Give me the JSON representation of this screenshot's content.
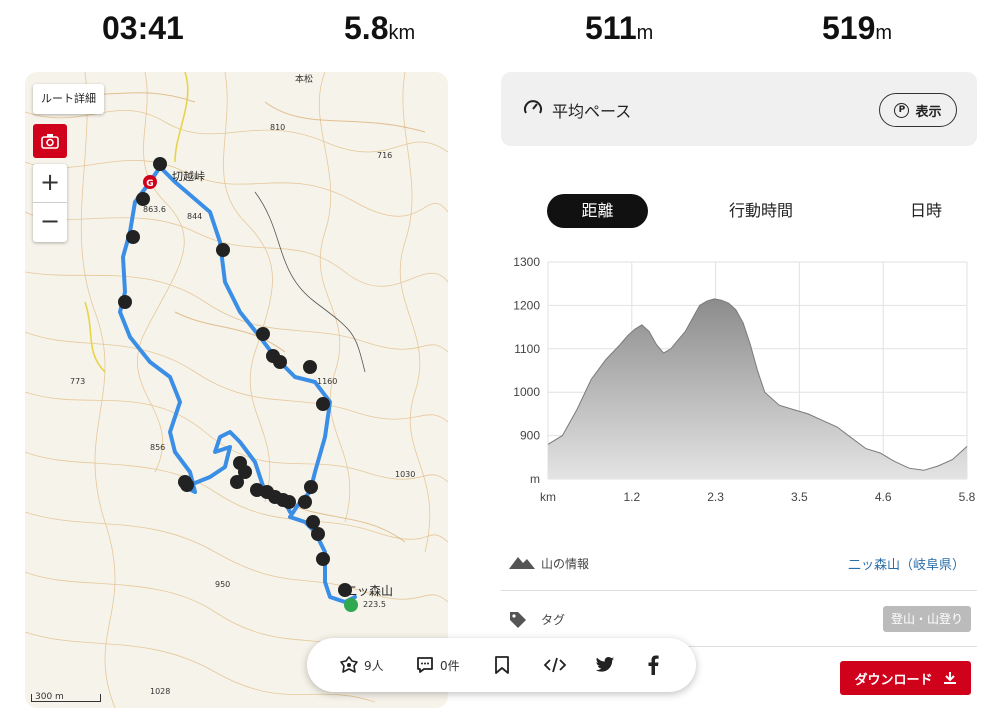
{
  "stats": {
    "time": "03:41",
    "distance": "5.8",
    "distance_unit": "km",
    "ascent": "511",
    "ascent_unit": "m",
    "descent": "519",
    "descent_unit": "m"
  },
  "map": {
    "route_detail_label": "ルート詳細",
    "zoom_in": "+",
    "zoom_out": "−",
    "scale_label": "300 m",
    "place_labels": {
      "pass": "切越峠",
      "peak": "二ッ森山",
      "honmatsu": "本松"
    },
    "elevation_labels": [
      "810",
      "716",
      "863.6",
      "844",
      "773",
      "1160",
      "856",
      "1030",
      "950",
      "223.5",
      "1028"
    ],
    "route_color": "#3a8ee6",
    "photo_marker_count": 34
  },
  "pace": {
    "label": "平均ペース",
    "button_label": "表示",
    "button_icon": "P"
  },
  "tabs": [
    {
      "label": "距離",
      "active": true
    },
    {
      "label": "行動時間",
      "active": false
    },
    {
      "label": "日時",
      "active": false
    }
  ],
  "chart_data": {
    "type": "area",
    "x_unit": "km",
    "y_unit": "m",
    "xlim": [
      0,
      5.8
    ],
    "ylim": [
      800,
      1300
    ],
    "x_ticks": [
      "km",
      "1.2",
      "2.3",
      "3.5",
      "4.6",
      "5.8"
    ],
    "y_ticks": [
      "1300",
      "1200",
      "1100",
      "1000",
      "900",
      "m"
    ],
    "grid": true,
    "x": [
      0,
      0.2,
      0.4,
      0.6,
      0.8,
      1.0,
      1.1,
      1.2,
      1.3,
      1.4,
      1.5,
      1.6,
      1.7,
      1.8,
      1.9,
      2.0,
      2.1,
      2.2,
      2.3,
      2.4,
      2.5,
      2.6,
      2.7,
      2.8,
      2.9,
      3.0,
      3.2,
      3.4,
      3.6,
      3.8,
      4.0,
      4.2,
      4.4,
      4.6,
      4.8,
      5.0,
      5.2,
      5.4,
      5.6,
      5.8
    ],
    "y": [
      880,
      900,
      960,
      1030,
      1075,
      1110,
      1130,
      1145,
      1155,
      1140,
      1110,
      1090,
      1100,
      1120,
      1140,
      1170,
      1200,
      1210,
      1215,
      1212,
      1205,
      1190,
      1160,
      1110,
      1050,
      1000,
      970,
      960,
      950,
      935,
      920,
      895,
      870,
      860,
      840,
      825,
      820,
      830,
      845,
      875
    ],
    "fill_color": "#aaaaaa"
  },
  "info": {
    "mountain_label": "山の情報",
    "mountain_value": "二ッ森山（岐阜県）",
    "tag_label": "タグ",
    "tag_value": "登山・山登り"
  },
  "download_label": "ダウンロード",
  "sharebar": {
    "likes": "9人",
    "comments": "0件"
  }
}
